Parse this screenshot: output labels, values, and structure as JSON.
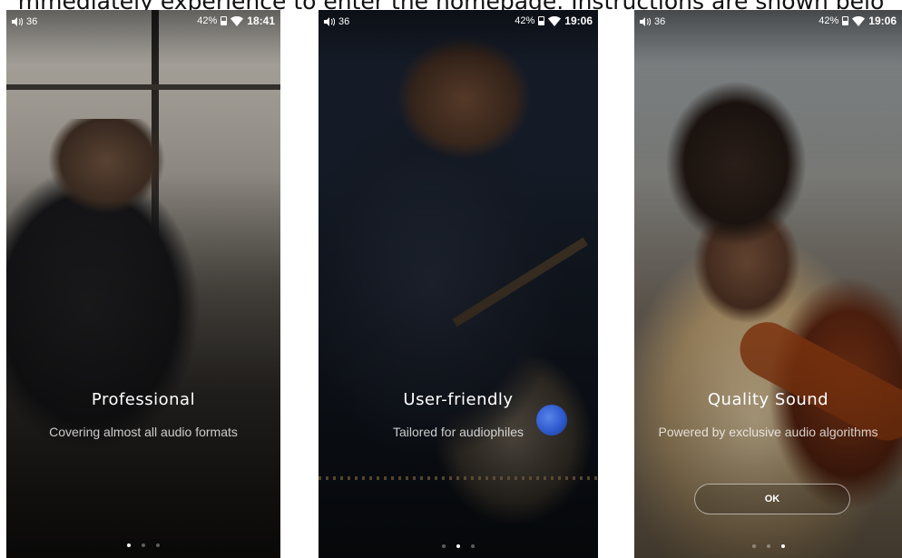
{
  "caption": "mmediately experience to enter the homepage. Instructions are shown belo",
  "screens": [
    {
      "status": {
        "volume": "36",
        "battery": "42%",
        "time": "18:41"
      },
      "title": "Professional",
      "subtitle": "Covering almost all audio formats",
      "dots": {
        "count": 3,
        "active": 0
      }
    },
    {
      "status": {
        "volume": "36",
        "battery": "42%",
        "time": "19:06"
      },
      "title": "User-friendly",
      "subtitle": "Tailored for audiophiles",
      "dots": {
        "count": 3,
        "active": 1
      }
    },
    {
      "status": {
        "volume": "36",
        "battery": "42%",
        "time": "19:06"
      },
      "title": "Quality Sound",
      "subtitle": "Powered by exclusive audio algorithms",
      "button_label": "OK",
      "dots": {
        "count": 3,
        "active": 2
      }
    }
  ],
  "icons": [
    "volume-icon",
    "battery-icon",
    "wifi-icon"
  ],
  "colors": {
    "accent_orb": "#2e5fe0",
    "text": "#ffffff"
  }
}
